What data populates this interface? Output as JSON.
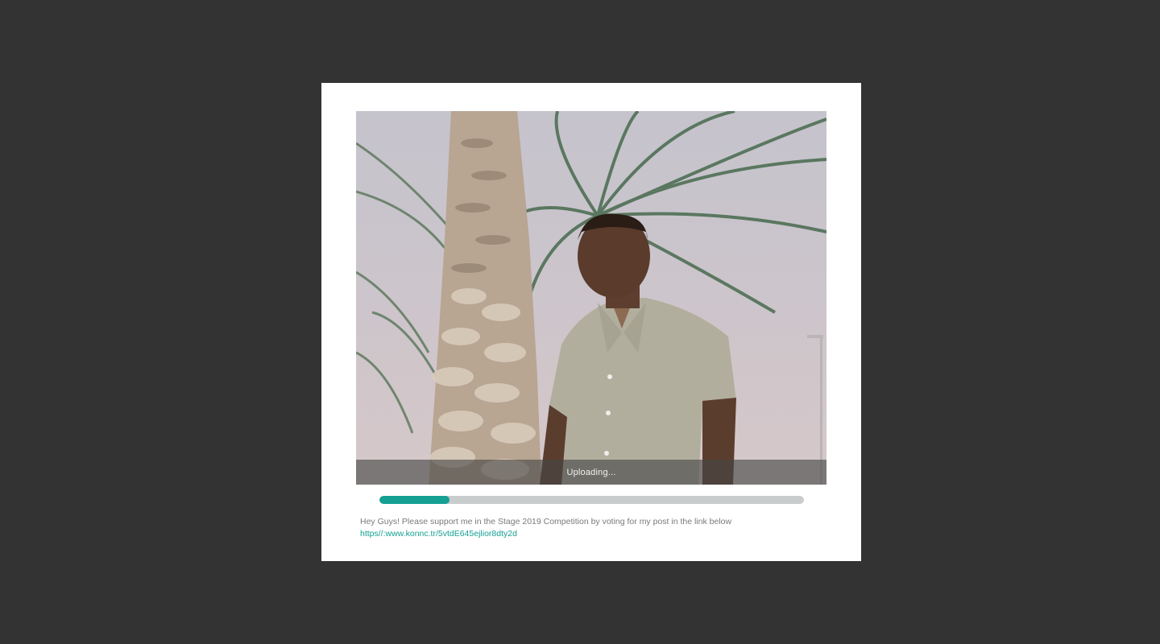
{
  "modal": {
    "image_alt": "Man in khaki shirt standing in front of palm trees",
    "upload_status": "Uploading...",
    "upload_progress_percent": 16.5,
    "caption_text": "Hey Guys! Please support me in the Stage 2019 Competition by voting for my post in the link below",
    "caption_link": "https//:www.konnc.tr/5vtdE645ejlior8dty2d"
  },
  "colors": {
    "backdrop": "#333333",
    "accent": "#14a093",
    "track": "#c9cccc"
  }
}
